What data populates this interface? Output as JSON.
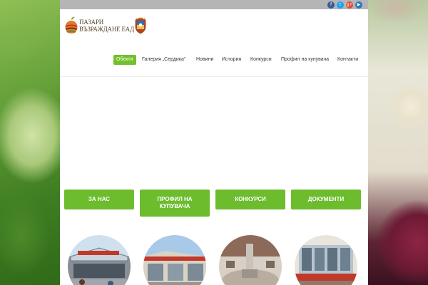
{
  "header": {
    "logo_line1": "ПАЗАРИ",
    "logo_line2": "ВЪЗРАЖДАНЕ ЕАД"
  },
  "social": [
    {
      "icon": "facebook-icon",
      "glyph": "f",
      "color": "#3b5998"
    },
    {
      "icon": "twitter-icon",
      "glyph": "t",
      "color": "#1da1f2"
    },
    {
      "icon": "google-plus-icon",
      "glyph": "g+",
      "color": "#dd4b39"
    },
    {
      "icon": "youtube-icon",
      "glyph": "▶",
      "color": "#2a7ab8"
    }
  ],
  "nav": {
    "items": [
      {
        "label": "Обекти",
        "active": true
      },
      {
        "label": "Галерия „Сердика“",
        "active": false
      },
      {
        "label": "Новини",
        "active": false
      },
      {
        "label": "История",
        "active": false
      },
      {
        "label": "Конкурси",
        "active": false
      },
      {
        "label": "Профил на купувача",
        "active": false
      },
      {
        "label": "Контакти",
        "active": false
      }
    ]
  },
  "buttons": [
    {
      "label": "ЗА НАС"
    },
    {
      "label": "ПРОФИЛ НА КУПУВАЧА"
    },
    {
      "label": "КОНКУРСИ"
    },
    {
      "label": "ДОКУМЕНТИ"
    }
  ],
  "colors": {
    "accent": "#72c02c",
    "button": "#6cbc2e",
    "topbar": "#b5b5b5"
  }
}
